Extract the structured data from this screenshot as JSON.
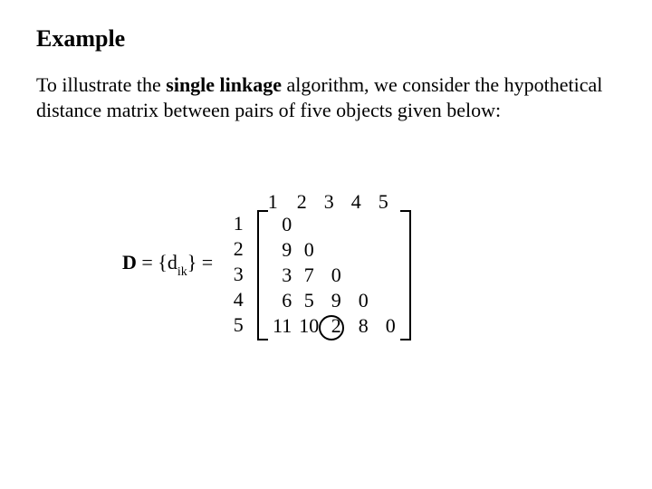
{
  "heading": "Example",
  "paragraph": {
    "pre": "To illustrate the ",
    "bold": "single linkage",
    "post": " algorithm, we consider the hypothetical distance matrix between pairs of five objects given below:"
  },
  "formula": {
    "D": "D",
    "eq1": " = {d",
    "sub": "ik",
    "eq2": "} = "
  },
  "row_labels": [
    "1",
    "2",
    "3",
    "4",
    "5"
  ],
  "col_labels": [
    "1",
    "2",
    "3",
    "4",
    "5"
  ],
  "matrix": {
    "r0": {
      "c0": "0",
      "c1": "",
      "c2": "",
      "c3": "",
      "c4": ""
    },
    "r1": {
      "c0": "9",
      "c1": "0",
      "c2": "",
      "c3": "",
      "c4": ""
    },
    "r2": {
      "c0": "3",
      "c1": "7",
      "c2": "0",
      "c3": "",
      "c4": ""
    },
    "r3": {
      "c0": "6",
      "c1": "5",
      "c2": "9",
      "c3": "0",
      "c4": ""
    },
    "r4": {
      "c0": "11",
      "c1": "10",
      "c2": "2",
      "c3": "8",
      "c4": "0"
    }
  },
  "circled": {
    "row": 4,
    "col": 2
  }
}
